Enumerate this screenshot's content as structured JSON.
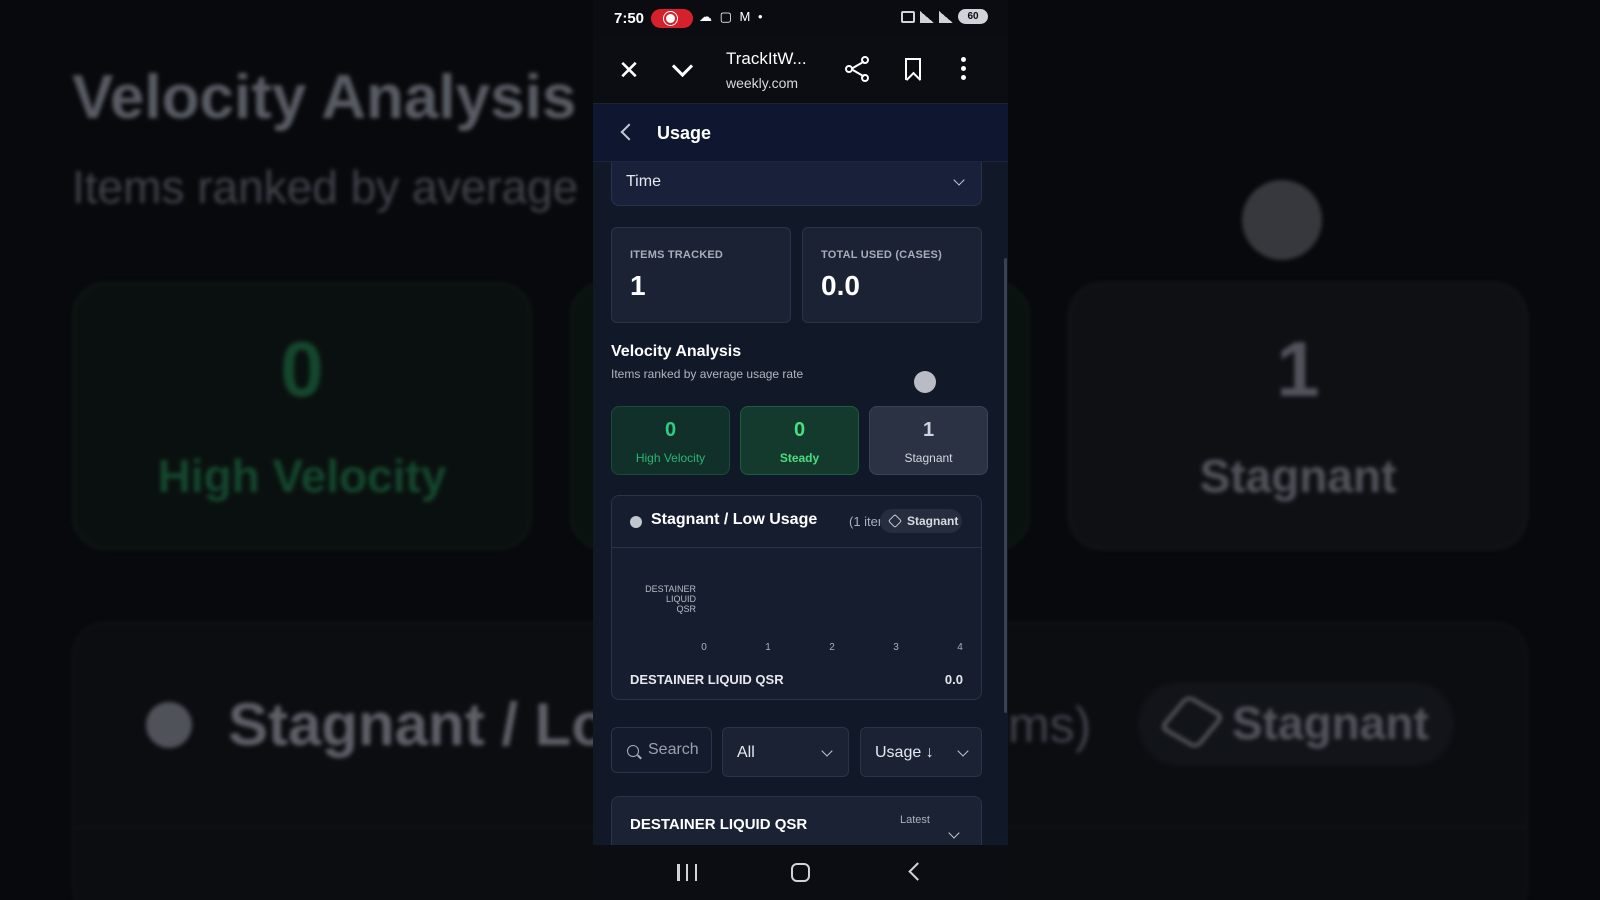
{
  "background": {
    "title": "Velocity Analysis",
    "subtitle": "Items ranked by average",
    "cards": [
      {
        "value": "0",
        "label": "High Velocity"
      },
      {
        "value": "1",
        "label": "Stagnant"
      }
    ],
    "panel_title": "Stagnant / Lo",
    "panel_count": "ms)",
    "panel_badge": "Stagnant"
  },
  "status_bar": {
    "time": "7:50",
    "notification_icons": "☁ ▢ M •",
    "battery": "60"
  },
  "browser": {
    "title": "TrackItW...",
    "url": "weekly.com"
  },
  "app_header": {
    "title": "Usage"
  },
  "filter": {
    "time_select": "Time"
  },
  "stats": [
    {
      "label": "ITEMS TRACKED",
      "value": "1"
    },
    {
      "label": "TOTAL USED (CASES)",
      "value": "0.0"
    }
  ],
  "velocity": {
    "title": "Velocity Analysis",
    "subtitle": "Items ranked by average usage rate",
    "cards": [
      {
        "value": "0",
        "label": "High Velocity"
      },
      {
        "value": "0",
        "label": "Steady"
      },
      {
        "value": "1",
        "label": "Stagnant"
      }
    ]
  },
  "stagnant_panel": {
    "title": "Stagnant / Low Usage",
    "count": "(1 items)",
    "badge": "Stagnant",
    "row_name": "DESTAINER LIQUID QSR",
    "row_value": "0.0"
  },
  "chart_data": {
    "type": "bar",
    "orientation": "horizontal",
    "categories": [
      "DESTAINER LIQUID QSR"
    ],
    "values": [
      0
    ],
    "x_ticks": [
      "0",
      "1",
      "2",
      "3",
      "4"
    ],
    "xlim": [
      0,
      4
    ],
    "category_label_lines": [
      "DESTAINER",
      "LIQUID",
      "QSR"
    ]
  },
  "controls": {
    "search_placeholder": "Search",
    "category_select": "All",
    "sort_select": "Usage ↓"
  },
  "item_list": [
    {
      "name": "DESTAINER LIQUID QSR",
      "latest_label": "Latest"
    }
  ]
}
